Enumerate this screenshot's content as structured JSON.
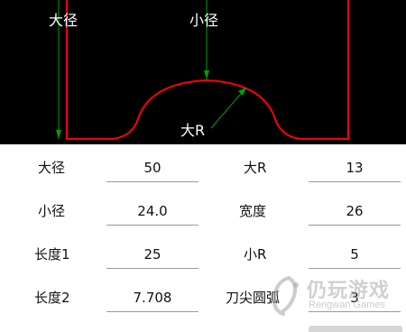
{
  "drawing": {
    "label_large_diameter": "大径",
    "label_small_diameter": "小径",
    "label_large_r": "大R",
    "colors": {
      "background": "#000000",
      "profile": "#ff0000",
      "dimension": "#00a000",
      "text": "#ffffff"
    }
  },
  "fields": [
    {
      "id": "large-diameter",
      "label": "大径",
      "value": "50"
    },
    {
      "id": "large-r",
      "label": "大R",
      "value": "13"
    },
    {
      "id": "small-diameter",
      "label": "小径",
      "value": "24.0"
    },
    {
      "id": "width",
      "label": "宽度",
      "value": "26"
    },
    {
      "id": "length1",
      "label": "长度1",
      "value": "25"
    },
    {
      "id": "small-r",
      "label": "小R",
      "value": "5"
    },
    {
      "id": "length2",
      "label": "长度2",
      "value": "7.708"
    },
    {
      "id": "tool-tip-arc",
      "label": "刀尖圆弧",
      "value": "3"
    }
  ],
  "watermark": {
    "text": "仍玩游戏",
    "subtext": "Rengwan Games"
  }
}
